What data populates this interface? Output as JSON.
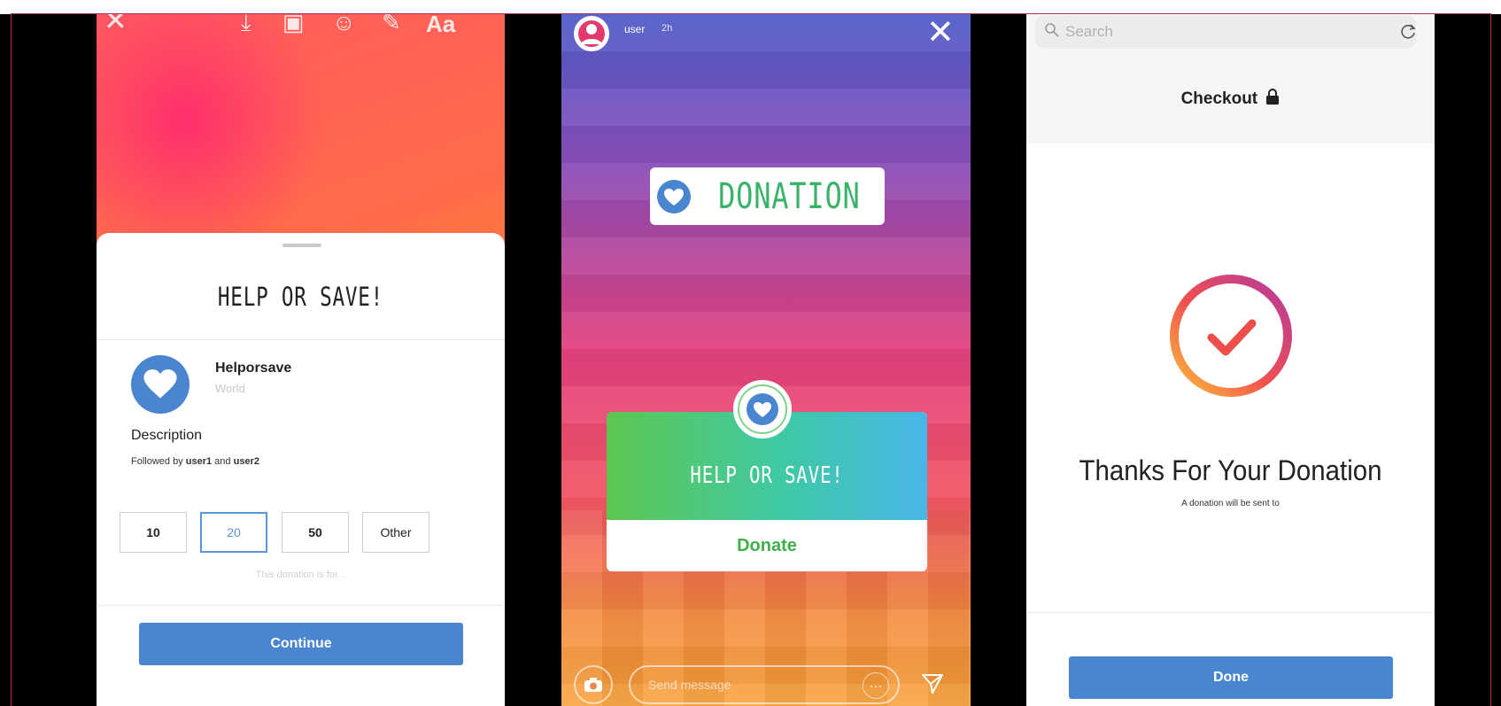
{
  "screen1": {
    "top_icons": [
      "close-icon",
      "download-icon",
      "sticker-icon",
      "face-icon",
      "draw-icon",
      "Aa"
    ],
    "sheet_title": "HELP OR SAVE!",
    "org_name": "Helporsave",
    "org_sub": "World",
    "description_label": "Description",
    "followed_prefix": "Followed by ",
    "followed_user1": "user1",
    "followed_and": " and ",
    "followed_user2": "user2",
    "amounts": [
      "10",
      "20",
      "50",
      "Other"
    ],
    "selected_amount": "20",
    "note": "This donation is for...",
    "continue_label": "Continue"
  },
  "screen2": {
    "username": "user",
    "time": "2h",
    "donation_tag": "DONATION",
    "card_title": "HELP OR SAVE!",
    "donate_label": "Donate",
    "message_placeholder": "Send message",
    "dots": "···"
  },
  "screen3": {
    "search_placeholder": "Search",
    "checkout_title": "Checkout",
    "thanks_title": "Thanks For Your Donation",
    "thanks_sub": "A donation will be sent to",
    "done_label": "Done"
  },
  "colors": {
    "primary_blue": "#4a86cf",
    "green": "#3eb04a",
    "instagram_gradient": [
      "#ffb030",
      "#f25563",
      "#8a4db8"
    ]
  }
}
